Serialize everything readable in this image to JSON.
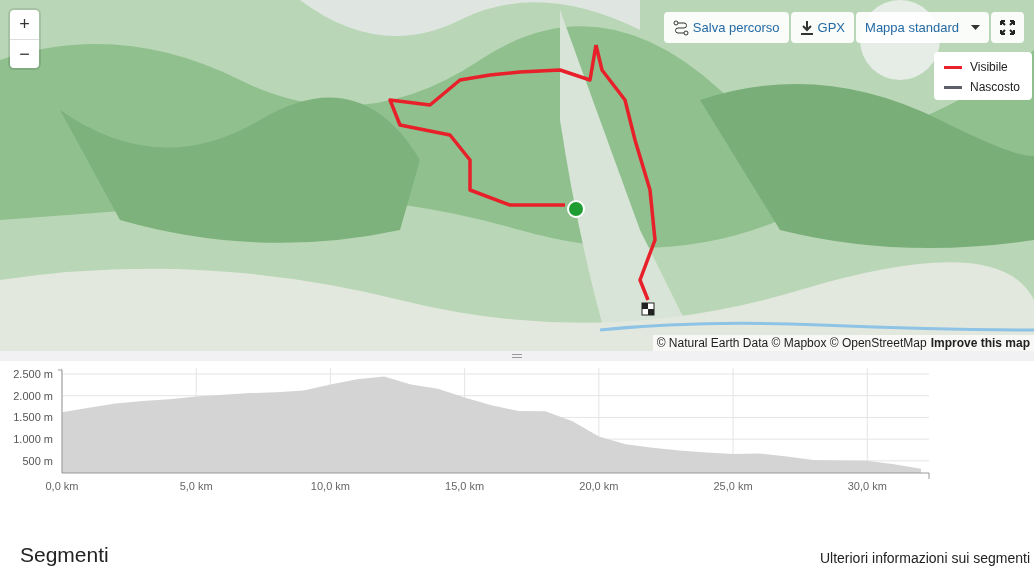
{
  "map": {
    "kind": "picture",
    "zoom_controls": [
      "+",
      "−"
    ],
    "toolbar": [
      {
        "kind": "route",
        "label": "Salva percorso"
      },
      {
        "kind": "download",
        "label": "GPX"
      },
      {
        "kind": "dropdown",
        "label": "Mappa standard"
      },
      {
        "kind": "fullscreen"
      }
    ],
    "legend": [
      {
        "label": "Visibile",
        "color": "#e8202a"
      },
      {
        "label": "Nascosto",
        "color": "#5d5f6b"
      }
    ],
    "attribution": {
      "text": "© Natural Earth Data © Mapbox © OpenStreetMap",
      "link": "Improve this map"
    }
  },
  "elevation": {
    "chart_data": {
      "type": "area",
      "x": [
        0,
        1,
        2,
        3,
        4,
        5,
        6,
        7,
        8,
        9,
        10,
        11,
        12,
        13,
        14,
        15,
        16,
        17,
        18,
        19,
        20,
        21,
        22,
        23,
        24,
        25,
        26,
        27,
        28,
        29,
        30,
        31,
        32
      ],
      "grid": true,
      "series": [
        {
          "color": "#d4d4d4",
          "values": [
            1620,
            1720,
            1820,
            1880,
            1920,
            1980,
            2020,
            2060,
            2080,
            2120,
            2260,
            2380,
            2440,
            2260,
            2160,
            1960,
            1780,
            1650,
            1640,
            1420,
            1060,
            880,
            800,
            740,
            690,
            660,
            670,
            600,
            520,
            510,
            500,
            420,
            320
          ]
        }
      ],
      "xlim": [
        0,
        32.3
      ],
      "ylim": [
        220,
        2500
      ],
      "xticks": [
        {
          "value": 0,
          "label": "0,0 km"
        },
        {
          "value": 5,
          "label": "5,0 km"
        },
        {
          "value": 10,
          "label": "10,0 km"
        },
        {
          "value": 15,
          "label": "15,0 km"
        },
        {
          "value": 20,
          "label": "20,0 km"
        },
        {
          "value": 25,
          "label": "25,0 km"
        },
        {
          "value": 30,
          "label": "30,0 km"
        }
      ],
      "yticks": [
        {
          "value": 500,
          "label": "500 m"
        },
        {
          "value": 1000,
          "label": "1.000 m"
        },
        {
          "value": 1500,
          "label": "1.500 m"
        },
        {
          "value": 2000,
          "label": "2.000 m"
        },
        {
          "value": 2500,
          "label": "2.500 m"
        }
      ]
    }
  },
  "segments": {
    "title": "Segmenti",
    "link": "Ulteriori informazioni sui segmenti"
  }
}
